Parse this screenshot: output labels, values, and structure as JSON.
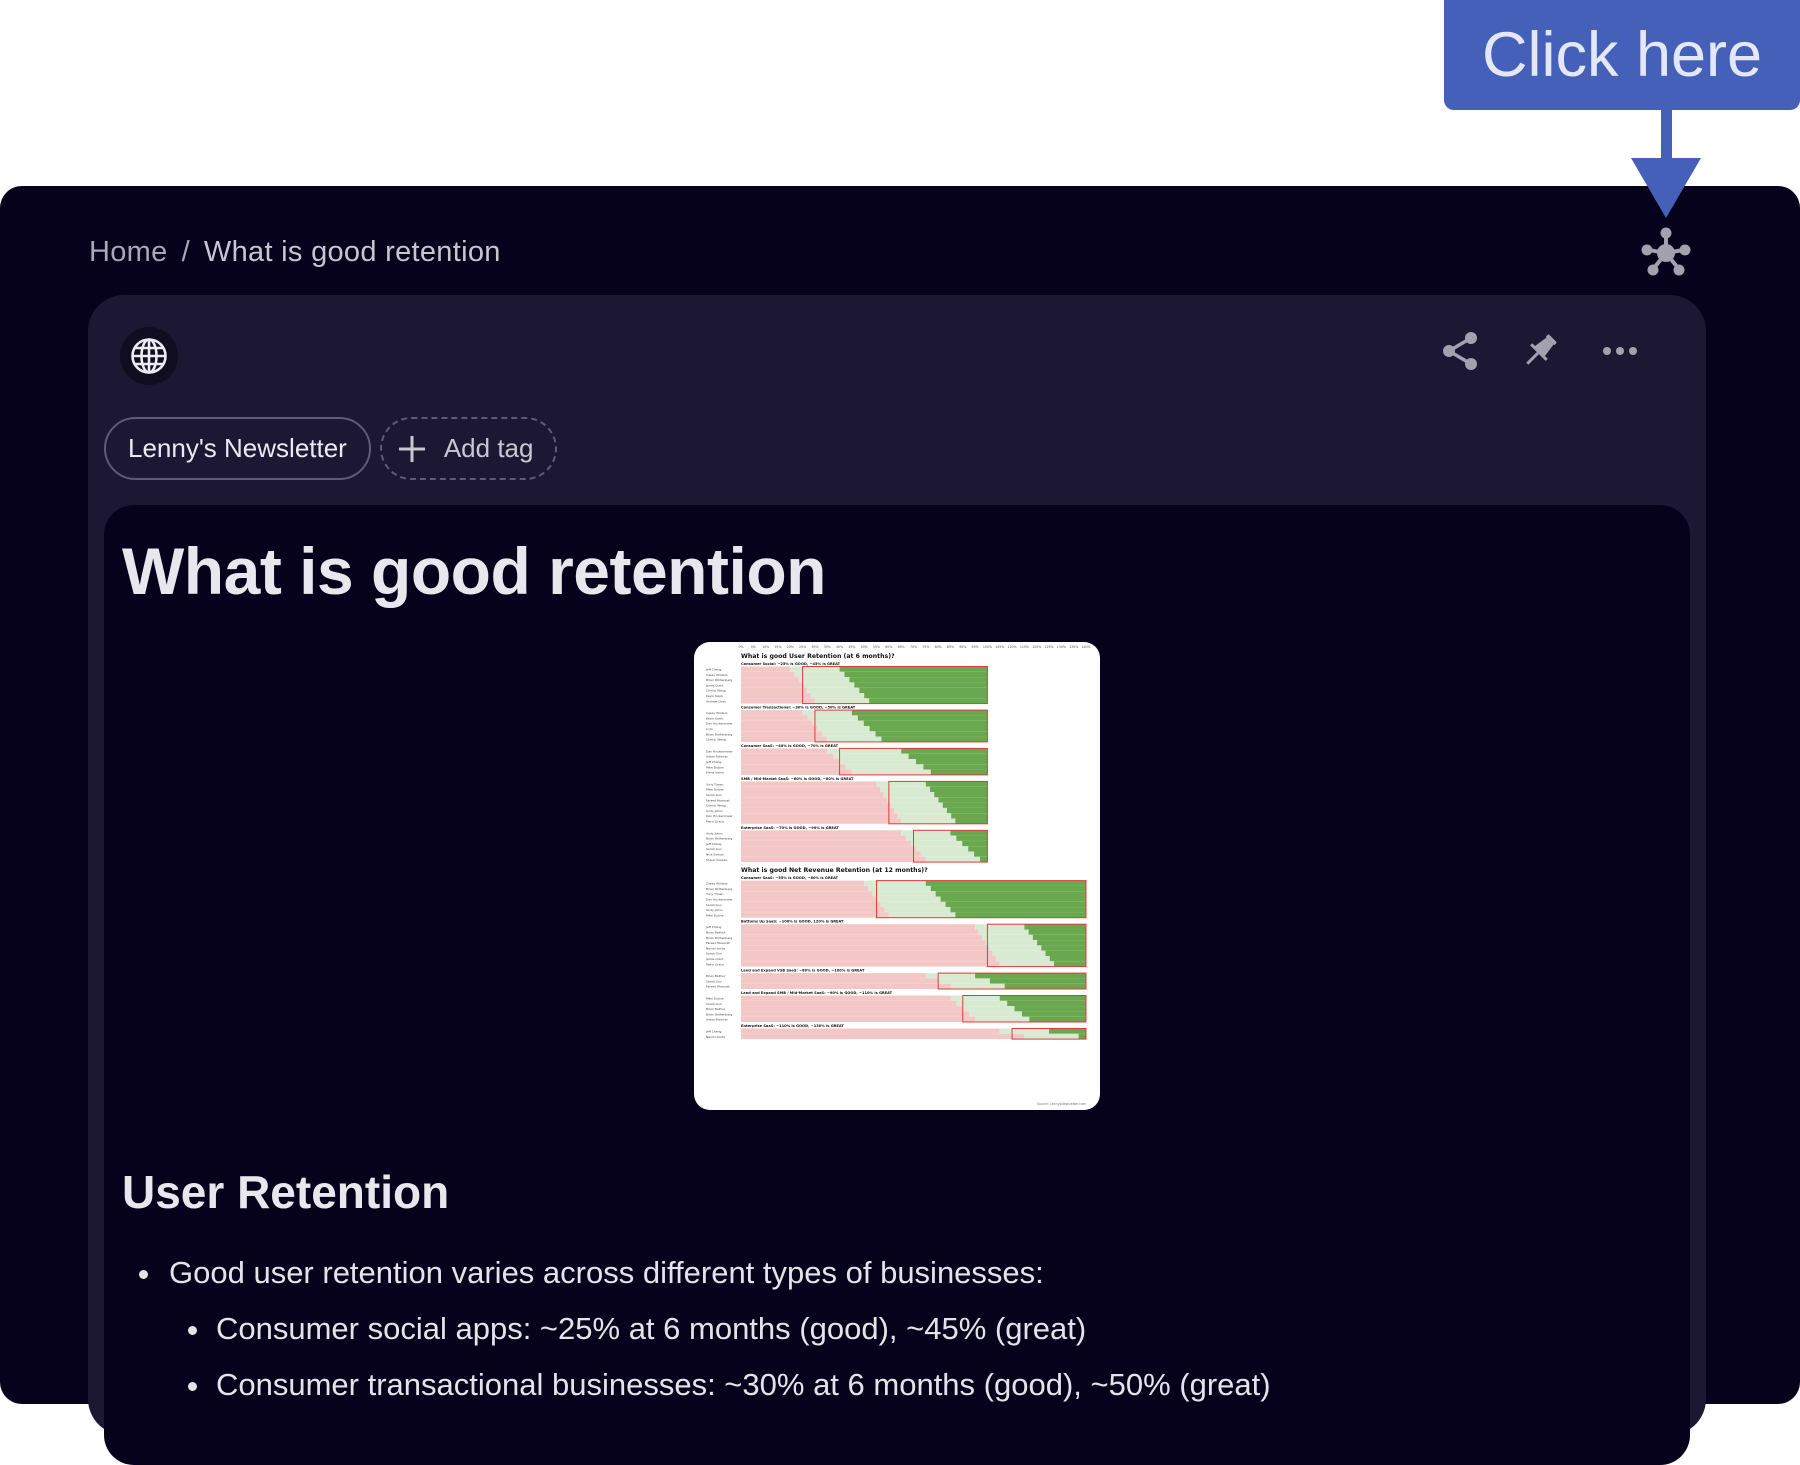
{
  "annotation": {
    "label": "Click here",
    "color": "#4560b8"
  },
  "breadcrumb": {
    "home": "Home",
    "separator": "/",
    "current": "What is good retention"
  },
  "toolbar": {
    "graph_icon": "network-graph-icon",
    "share_icon": "share-icon",
    "pin_icon": "pin-icon",
    "more_icon": "more-horizontal-icon"
  },
  "source_icon": "globe-icon",
  "tags": [
    {
      "label": "Lenny's Newsletter"
    }
  ],
  "add_tag_label": "Add tag",
  "document": {
    "title": "What is good retention",
    "image": {
      "axis_labels": [
        "0%",
        "5%",
        "10%",
        "15%",
        "20%",
        "25%",
        "30%",
        "35%",
        "40%",
        "45%",
        "50%",
        "55%",
        "60%",
        "65%",
        "70%",
        "75%",
        "80%",
        "85%",
        "90%",
        "95%",
        "100%",
        "105%",
        "110%",
        "115%",
        "120%",
        "125%",
        "130%",
        "135%",
        "140%"
      ],
      "source": "Source: LennysNewsletter.com",
      "groups": [
        {
          "title": "What is good User Retention (at 6 months)?",
          "sections": [
            {
              "label": "Consumer Social: ~25% is GOOD, ~45% is GREAT",
              "good": 25,
              "great": 45,
              "max": 100,
              "rows": [
                "Jeff Chang",
                "Casey Winters",
                "Brian Rothenberg",
                "Jamie Quint",
                "ChenLi Wang",
                "Kevin Kwok",
                "Andrew Chen"
              ]
            },
            {
              "label": "Consumer Transactional: ~30% is GOOD, ~50% is GREAT",
              "good": 30,
              "great": 50,
              "max": 100,
              "rows": [
                "Casey Winters",
                "Kevin Kwok",
                "Dan Hockenmaier",
                "Li Jin",
                "Brian Rothenberg",
                "ChenLi Wang"
              ]
            },
            {
              "label": "Consumer SaaS: ~40% is GOOD, ~70% is GREAT",
              "good": 40,
              "great": 70,
              "max": 100,
              "rows": [
                "Dan Hockenmaier",
                "Adam Fishman",
                "Jeff Chang",
                "Mike Duboe",
                "Elena Verna"
              ]
            },
            {
              "label": "SMB / Mid-Market SaaS: ~60% is GOOD, ~80% is GREAT",
              "good": 60,
              "great": 80,
              "max": 100,
              "rows": [
                "Yuriy Timen",
                "Mike Duboe",
                "Sarah Guo",
                "Fareed Mosavat",
                "ChenLi Wang",
                "Andy Johns",
                "Dan Hockenmaier",
                "Merci Grace"
              ]
            },
            {
              "label": "Enterprise SaaS: ~70% is GOOD, ~90% is GREAT",
              "good": 70,
              "great": 90,
              "max": 100,
              "rows": [
                "Andy Johns",
                "Brian Rothenberg",
                "Jeff Chang",
                "Sarah Guo",
                "Nick Soman",
                "Shaun Clowes"
              ]
            }
          ]
        },
        {
          "title": "What is good Net Revenue Retention (at 12 months)?",
          "sections": [
            {
              "label": "Consumer SaaS: ~55% is GOOD, ~80% is GREAT",
              "good": 55,
              "great": 80,
              "max": 140,
              "rows": [
                "Casey Winters",
                "Brian Rothenberg",
                "Yuriy Timen",
                "Dan Hockenmaier",
                "Sarah Guo",
                "Andy Johns",
                "Mike Duboe"
              ]
            },
            {
              "label": "Bottoms Up SaaS: ~100% is GOOD, 120% is GREAT",
              "good": 100,
              "great": 120,
              "max": 140,
              "rows": [
                "Jeff Chang",
                "Brian Balfour",
                "Brian Rothenberg",
                "Fareed Mosavat",
                "Naomi Ionita",
                "Sarah Guo",
                "Jamie Quint",
                "Merci Grace"
              ]
            },
            {
              "label": "Land and Expand VSB SaaS: ~80% is GOOD, ~100% is GREAT",
              "good": 80,
              "great": 100,
              "max": 140,
              "rows": [
                "Brian Balfour",
                "Sarah Guo",
                "Fareed Mosavat"
              ]
            },
            {
              "label": "Land and Expand SMB / Mid-Market SaaS: ~90% is GOOD, ~110% is GREAT",
              "good": 90,
              "great": 110,
              "max": 140,
              "rows": [
                "Mike Duboe",
                "Sarah Guo",
                "Brian Balfour",
                "Brian Rothenberg",
                "Adam Fishman"
              ]
            },
            {
              "label": "Enterprise SaaS: ~110% is GOOD, ~130% is GREAT",
              "good": 110,
              "great": 130,
              "max": 140,
              "rows": [
                "Jeff Chang",
                "Naomi Ionita"
              ]
            }
          ]
        }
      ]
    },
    "section_heading": "User Retention",
    "bullets": [
      {
        "level": 1,
        "text": "Good user retention varies across different types of businesses:"
      },
      {
        "level": 2,
        "text": "Consumer social apps: ~25% at 6 months (good), ~45% (great)"
      },
      {
        "level": 2,
        "text": "Consumer transactional businesses: ~30% at 6 months (good), ~50% (great)"
      }
    ]
  }
}
